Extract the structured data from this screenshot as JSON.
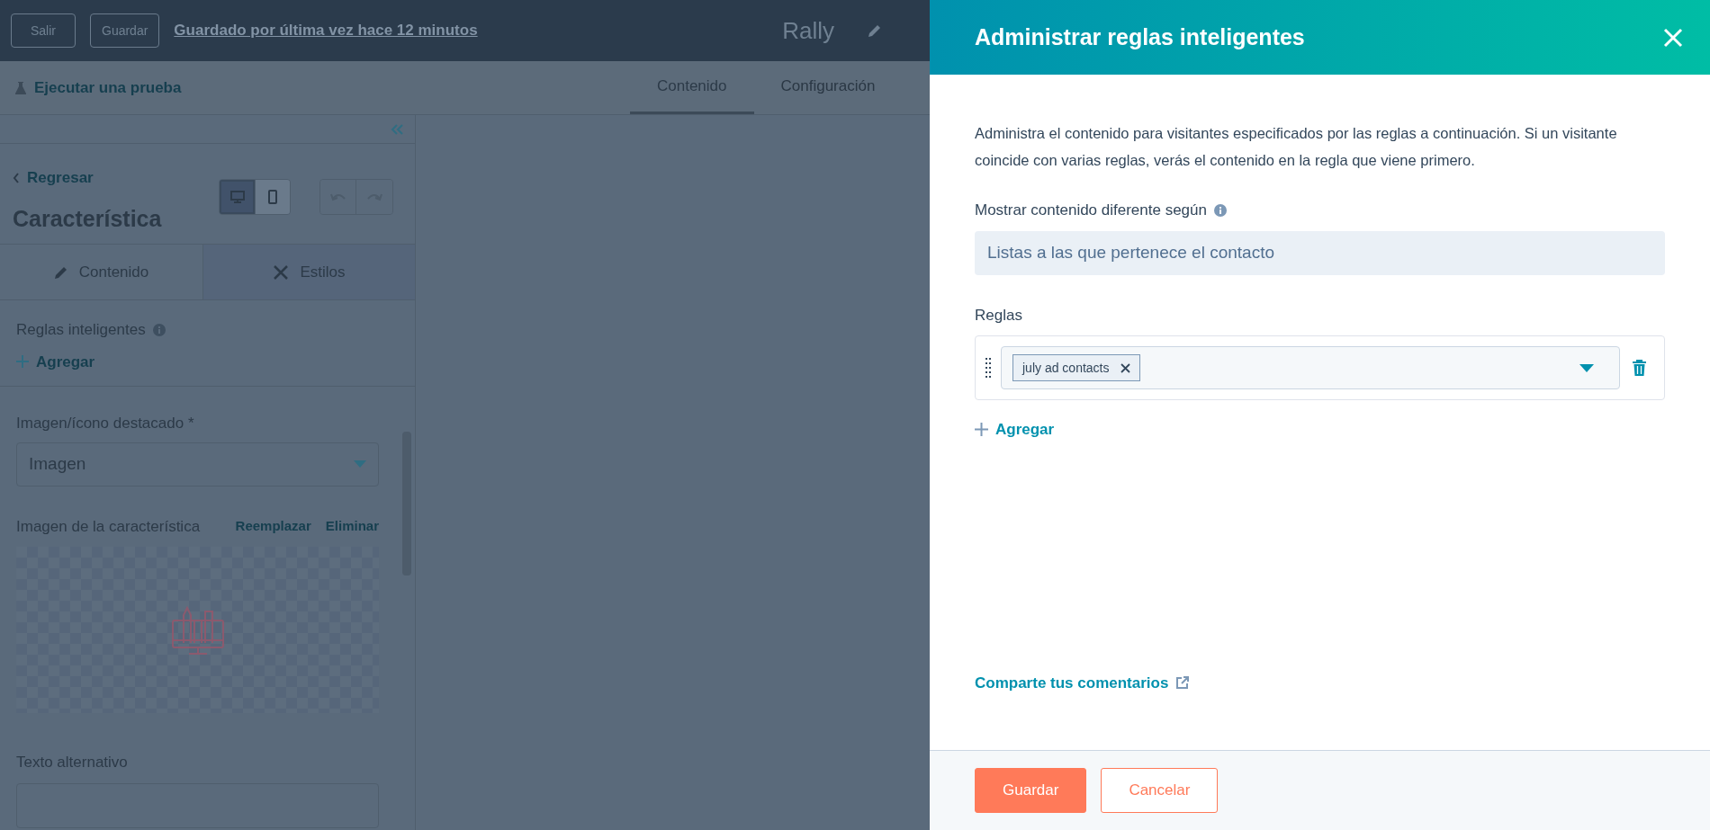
{
  "top_bar": {
    "buttons": [
      "Salir",
      "Guardar"
    ],
    "saved_link": "Guardado por última vez hace 12 minutos",
    "page_title": "Rally"
  },
  "sub_bar": {
    "test_link": "Ejecutar una prueba",
    "tabs": [
      {
        "label": "Contenido",
        "selected": true
      },
      {
        "label": "Configuración",
        "selected": false
      }
    ]
  },
  "sidebar": {
    "back_link": "Regresar",
    "module_title": "Característica",
    "devices": [
      {
        "kind": "desktop",
        "selected": true
      },
      {
        "kind": "mobile",
        "selected": false
      }
    ],
    "tabs": [
      {
        "label": "Contenido",
        "kind": "pencil",
        "selected": true
      },
      {
        "label": "Estilos",
        "kind": "brush",
        "selected": false
      }
    ],
    "smart_rules_label": "Reglas inteligentes",
    "add_link": "Agregar",
    "image_type_label": "Imagen/ícono destacado *",
    "image_type_value": "Imagen",
    "image_label": "Imagen de la característica",
    "replace_link": "Reemplazar",
    "remove_link": "Eliminar",
    "alt_text_label": "Texto alternativo"
  },
  "panel": {
    "title": "Administrar reglas inteligentes",
    "description": "Administra el contenido para visitantes especificados por las reglas a continuación. Si un visitante coincide con varias reglas, verás el contenido en la regla que viene primero.",
    "based_on_label": "Mostrar contenido diferente según",
    "based_on_value": "Listas a las que pertenece el contacto",
    "rules_label": "Reglas",
    "rules": [
      {
        "tags": [
          "july ad contacts"
        ]
      }
    ],
    "add_link": "Agregar",
    "feedback_link": "Comparte tus comentarios",
    "buttons": [
      {
        "label": "Guardar",
        "kind": "primary"
      },
      {
        "label": "Cancelar",
        "kind": "secondary"
      }
    ]
  }
}
